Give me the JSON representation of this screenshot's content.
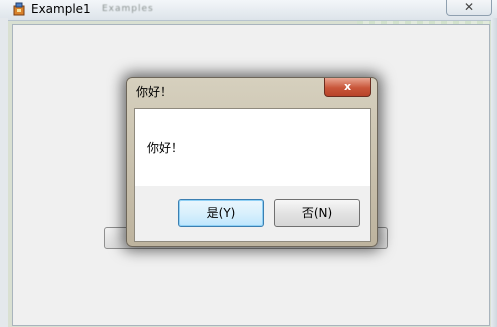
{
  "window": {
    "title": "Example1",
    "blurred_title": "Examples",
    "close_glyph": "✕"
  },
  "dialog": {
    "title": "你好！",
    "close_glyph": "x",
    "message": "你好！",
    "yes_label": "是(Y)",
    "no_label": "否(N)"
  },
  "colors": {
    "dialog_frame": "#c9c0ab",
    "close_button": "#c8563a",
    "default_button_border": "#3c7fb1"
  }
}
